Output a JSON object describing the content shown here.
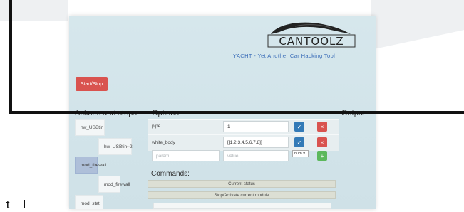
{
  "logo": {
    "text": "CANTOOLZ"
  },
  "tagline": "YACHT - Yet Another Car Hacking Tool",
  "controls": {
    "start_stop": "Start/Stop"
  },
  "columns": {
    "actions": "Actions and steps",
    "options": "Options",
    "output": "Output"
  },
  "modules": [
    {
      "label": "hw_USBtin",
      "active": false
    },
    {
      "label": "hw_USBtin~2",
      "active": false
    },
    {
      "label": "mod_firewall",
      "active": true
    },
    {
      "label": "mod_firewall",
      "active": false
    },
    {
      "label": "mod_stat",
      "active": false
    }
  ],
  "options": [
    {
      "name": "pipe",
      "value": "1"
    },
    {
      "name": "white_body",
      "value": "[[1,2,3,4,5,6,7,8]]"
    }
  ],
  "new_option": {
    "param_placeholder": "param",
    "value_placeholder": "value",
    "type": "num"
  },
  "commands": {
    "heading": "Commands:",
    "items": [
      "Current status",
      "Stop/Activate current module"
    ]
  },
  "icons": {
    "confirm": "check-icon",
    "remove": "x-icon",
    "add": "plus-icon"
  },
  "colors": {
    "primary": "#337ab7",
    "danger": "#d9534f",
    "success": "#5cb85c",
    "tagline": "#3a6db8"
  },
  "overlay": {
    "text": " t    l"
  }
}
